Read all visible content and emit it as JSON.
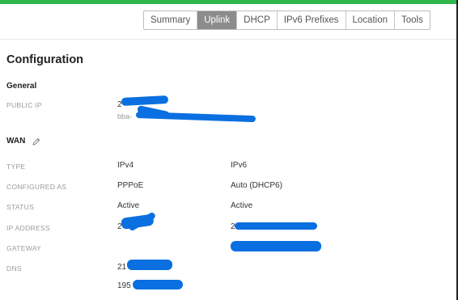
{
  "tabs": [
    "Summary",
    "Uplink",
    "DHCP",
    "IPv6 Prefixes",
    "Location",
    "Tools"
  ],
  "active_tab": "Uplink",
  "page_title": "Configuration",
  "general": {
    "title": "General",
    "public_ip": {
      "label": "PUBLIC IP",
      "line1": "2",
      "line2": "bba-"
    }
  },
  "wan": {
    "title": "WAN",
    "edit_icon": "pencil-icon",
    "rows": [
      {
        "label": "TYPE",
        "v4": "IPv4",
        "v6": "IPv6"
      },
      {
        "label": "CONFIGURED AS",
        "v4": "PPPoE",
        "v6": "Auto (DHCP6)"
      },
      {
        "label": "STATUS",
        "v4": "Active",
        "v6": "Active"
      },
      {
        "label": "IP ADDRESS",
        "v4": "2",
        "v6": "2"
      },
      {
        "label": "GATEWAY",
        "v4": "",
        "v6": ""
      },
      {
        "label": "DNS",
        "v4": "21",
        "v6": ""
      }
    ],
    "dns_secondary": "195"
  },
  "colors": {
    "accent": "#2fb64a",
    "active_tab": "#8c8c8c",
    "redaction": "#0a6fe0"
  }
}
